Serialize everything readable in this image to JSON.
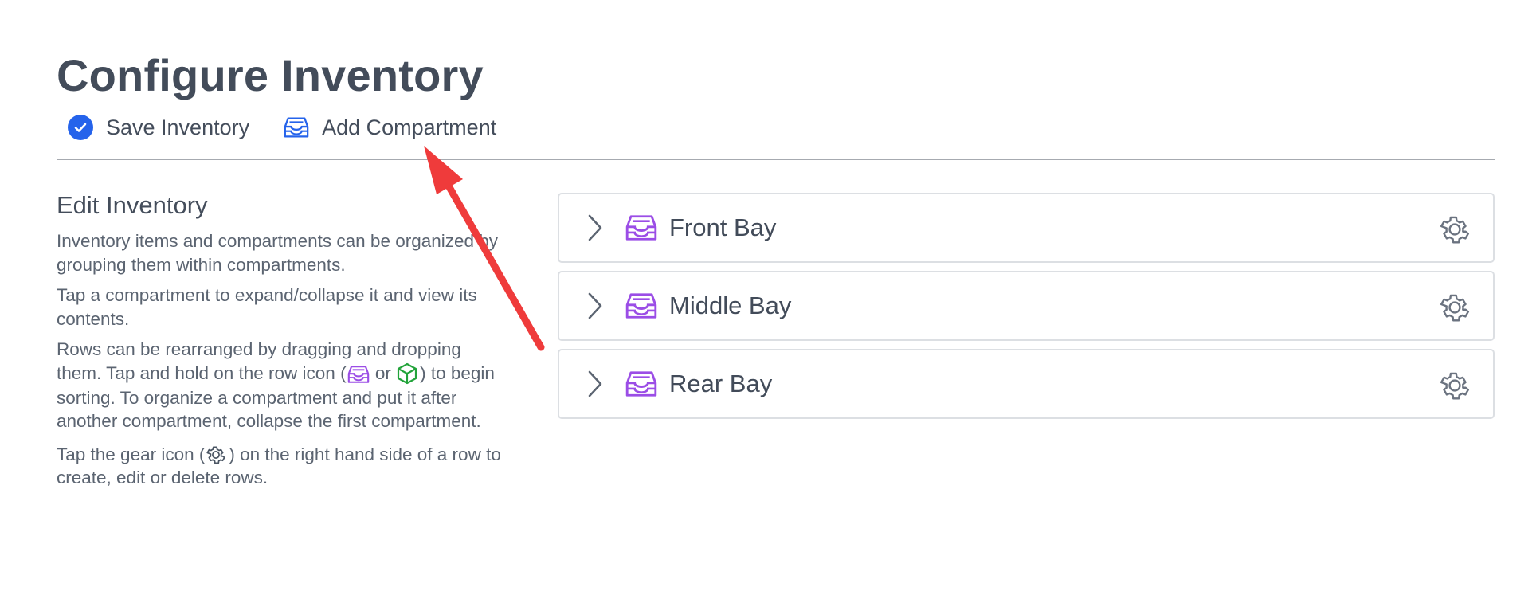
{
  "page": {
    "title": "Configure Inventory"
  },
  "toolbar": {
    "save_label": "Save Inventory",
    "add_label": "Add Compartment",
    "save_icon": "check-circle-icon",
    "add_icon": "tray-icon"
  },
  "sidebar": {
    "heading": "Edit Inventory",
    "p1": "Inventory items and compartments can be organized by grouping them within compartments.",
    "p2": "Tap a compartment to expand/collapse it and view its contents.",
    "p3_a": "Rows can be rearranged by dragging and dropping them. Tap and hold on the row icon (",
    "p3_or": " or ",
    "p3_b": ") to begin sorting. To organize a compartment and put it after another compartment, collapse the first compartment.",
    "p4_a": "Tap the gear icon (",
    "p4_b": ") on the right hand side of a row to create, edit or delete rows."
  },
  "compartments": [
    {
      "name": "Front Bay"
    },
    {
      "name": "Middle Bay"
    },
    {
      "name": "Rear Bay"
    }
  ],
  "colors": {
    "accent_blue": "#2563eb",
    "compartment_purple": "#9b4de6",
    "item_green": "#22a33a",
    "annotation_red": "#ef3b3b"
  }
}
